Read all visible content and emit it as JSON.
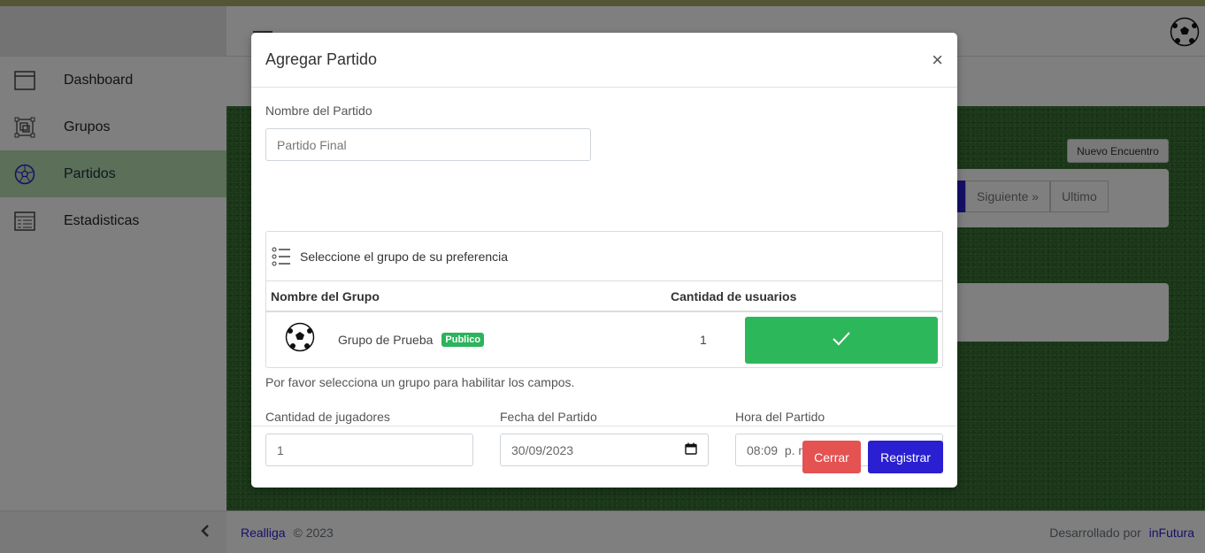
{
  "sidebar": {
    "items": [
      {
        "label": "Dashboard",
        "icon": "window-icon"
      },
      {
        "label": "Grupos",
        "icon": "group-icon"
      },
      {
        "label": "Partidos",
        "icon": "ball-icon",
        "active": true
      },
      {
        "label": "Estadisticas",
        "icon": "table-icon"
      }
    ],
    "collapse_icon": "chevron-left-icon"
  },
  "page": {
    "nuevo_label": "Nuevo Encuentro",
    "pager": {
      "next": "Siguiente »",
      "last": "Ultimo"
    }
  },
  "footer": {
    "brand": "Realliga",
    "copyright": "© 2023",
    "dev_prefix": "Desarrollado por",
    "dev_name": "inFutura"
  },
  "modal": {
    "title": "Agregar Partido",
    "close": "×",
    "name_label": "Nombre del Partido",
    "name_placeholder": "Partido Final",
    "group_prompt": "Seleccione el grupo de su preferencia",
    "table": {
      "headers": [
        "Nombre del Grupo",
        "Cantidad de usuarios"
      ],
      "rows": [
        {
          "name": "Grupo de Prueba",
          "badge": "Publico",
          "users": "1"
        }
      ]
    },
    "help": "Por favor selecciona un grupo para habilitar los campos.",
    "players_label": "Cantidad de jugadores",
    "players_value": "1",
    "date_label": "Fecha del Partido",
    "date_value": "30/09/2023",
    "time_label": "Hora del Partido",
    "time_value": "08:09  p. m.",
    "cancel": "Cerrar",
    "submit": "Registrar"
  },
  "colors": {
    "primary": "#2a1fd1",
    "success": "#2db75b",
    "danger": "#e45252",
    "sidebar_active": "#b9dfb3"
  }
}
